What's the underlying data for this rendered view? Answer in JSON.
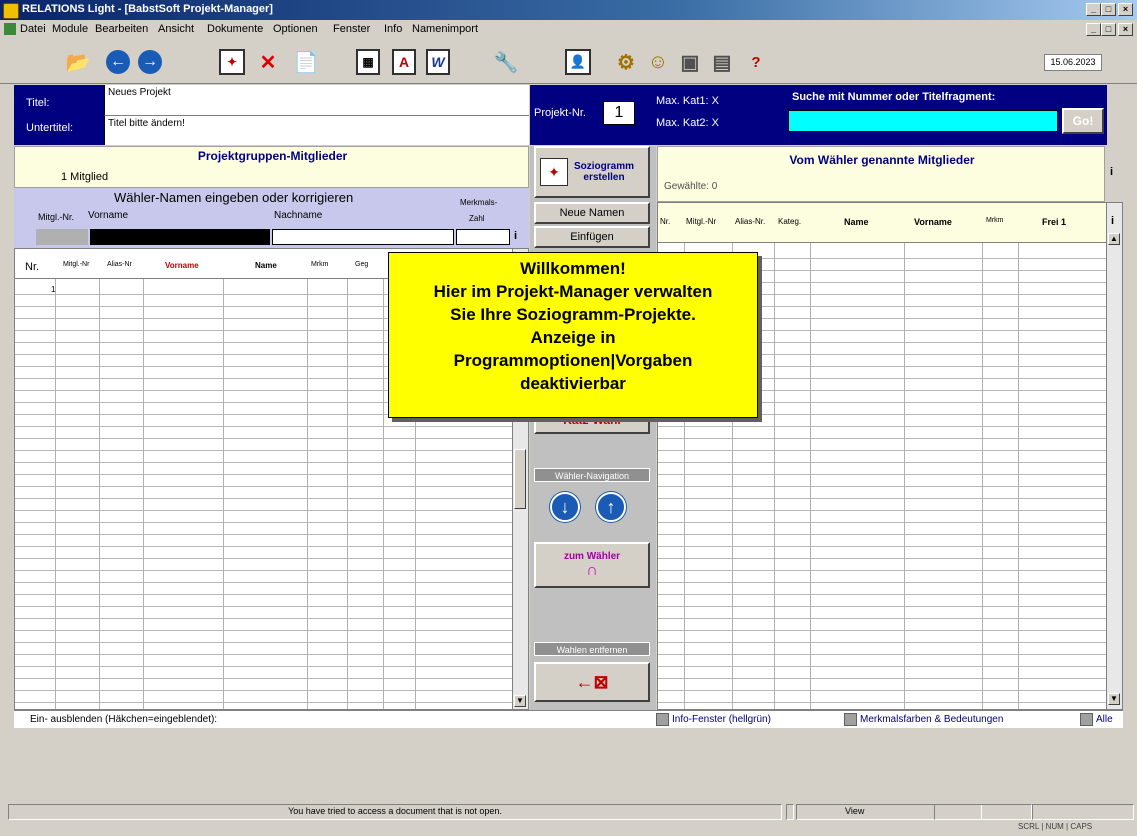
{
  "window": {
    "title": "RELATIONS Light - [BabstSoft Projekt-Manager]",
    "min": "_",
    "restore": "□",
    "close": "×"
  },
  "menu": [
    "Datei",
    "Module",
    "Bearbeiten",
    "Ansicht",
    "Dokumente",
    "Optionen",
    "Fenster",
    "Info",
    "Namenimport"
  ],
  "toolbar": {
    "date": "15.06.2023",
    "help_label": "?"
  },
  "project": {
    "title_label": "Titel:",
    "title_value": "Neues Projekt",
    "subtitle_label": "Untertitel:",
    "subtitle_value": "Titel bitte ändern!",
    "nr_label": "Projekt-Nr.",
    "nr_value": "1",
    "maxkat1": "Max. Kat1: X",
    "maxkat2": "Max. Kat2: X",
    "search_label": "Suche mit Nummer oder Titelfragment:",
    "search_value": "",
    "go_label": "Go!"
  },
  "left": {
    "group_title": "Projektgruppen-Mitglieder",
    "member_count": "1 Mitglied",
    "entry_title": "Wähler-Namen eingeben oder korrigieren",
    "merkmal_label": "Merkmals-",
    "zahl_label": "Zahl",
    "lbl_mitgl": "Mitgl.-Nr.",
    "lbl_vorname": "Vorname",
    "lbl_nachname": "Nachname",
    "info": "i",
    "grid_headers": [
      "Nr.",
      "Mitgl.-Nr",
      "Alias-Nr",
      "Vorname",
      "Name",
      "Mrkm",
      "Geg"
    ],
    "rows": [
      [
        "1",
        "",
        "",
        "",
        "",
        "",
        ""
      ]
    ]
  },
  "middle": {
    "soziogramm": "Soziogramm erstellen",
    "neue_namen": "Neue Namen",
    "einfuegen": "Einfügen",
    "katz_wahl": "Katz-Wahl",
    "wahler_nav": "Wähler-Navigation",
    "zum_wahler": "zum Wähler",
    "wahlen_entfernen": "Wahlen entfernen"
  },
  "right": {
    "title": "Vom Wähler genannte Mitglieder",
    "gewahlte": "Gewählte: 0",
    "grid_headers": [
      "Nr.",
      "Mitgl.-Nr",
      "Alias-Nr.",
      "Kateg.",
      "Name",
      "Vorname",
      "Mrkm",
      "Frei 1"
    ],
    "info": "i"
  },
  "popup": {
    "lines": [
      "Willkommen!",
      "Hier im Projekt-Manager verwalten",
      "Sie Ihre Soziogramm-Projekte.",
      "Anzeige in",
      "Programmoptionen|Vorgaben",
      "deaktivierbar"
    ]
  },
  "bottom": {
    "toggle_label": "Ein- ausblenden (Häkchen=eingeblendet):",
    "info_fenster": "Info-Fenster (hellgrün)",
    "merkmal_farben": "Merkmalsfarben & Bedeutungen",
    "alle": "Alle"
  },
  "status": {
    "message": "You have tried to access a document that is not open.",
    "view": "View",
    "scrl": "SCRL",
    "num": "NUM",
    "caps": "CAPS"
  },
  "colors": {
    "navy": "#000080",
    "cyan": "#00ffff",
    "yellow": "#ffff00",
    "cream": "#fdfde0",
    "lavender": "#c8c8ec"
  }
}
